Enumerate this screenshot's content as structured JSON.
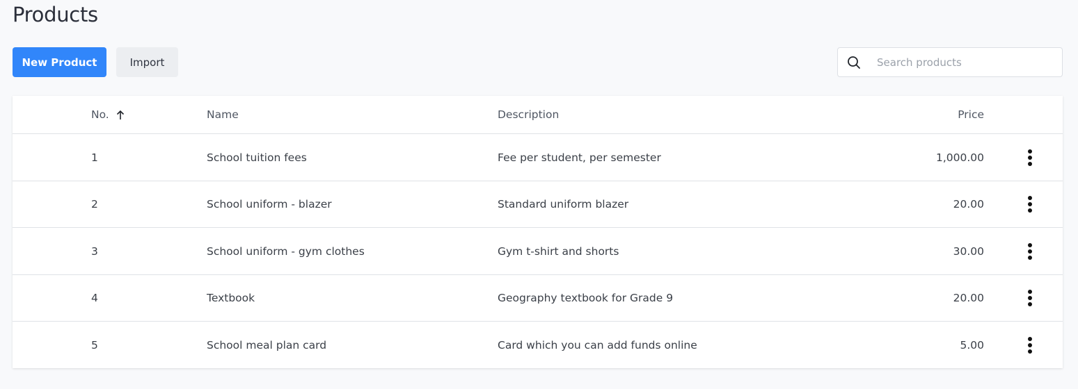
{
  "page": {
    "title": "Products"
  },
  "toolbar": {
    "new_product_label": "New Product",
    "import_label": "Import",
    "search_placeholder": "Search products",
    "search_value": ""
  },
  "colors": {
    "primary": "#3186fa",
    "secondary_button": "#eceef1",
    "background": "#f8f9fb"
  },
  "table": {
    "columns": [
      {
        "key": "no",
        "label": "No.",
        "sorted": "ascending",
        "sort_icon": "arrow-up-icon"
      },
      {
        "key": "name",
        "label": "Name"
      },
      {
        "key": "description",
        "label": "Description"
      },
      {
        "key": "price",
        "label": "Price"
      }
    ],
    "rows": [
      {
        "no": "1",
        "name": "School tuition fees",
        "description": "Fee per student, per semester",
        "price": "1,000.00",
        "menu_icon": "more-vertical-icon"
      },
      {
        "no": "2",
        "name": "School uniform - blazer",
        "description": "Standard uniform blazer",
        "price": "20.00",
        "menu_icon": "more-vertical-icon"
      },
      {
        "no": "3",
        "name": "School uniform - gym clothes",
        "description": "Gym t-shirt and shorts",
        "price": "30.00",
        "menu_icon": "more-vertical-icon"
      },
      {
        "no": "4",
        "name": "Textbook",
        "description": "Geography textbook for Grade 9",
        "price": "20.00",
        "menu_icon": "more-vertical-icon"
      },
      {
        "no": "5",
        "name": "School meal plan card",
        "description": "Card which you can add funds online",
        "price": "5.00",
        "menu_icon": "more-vertical-icon"
      }
    ]
  }
}
